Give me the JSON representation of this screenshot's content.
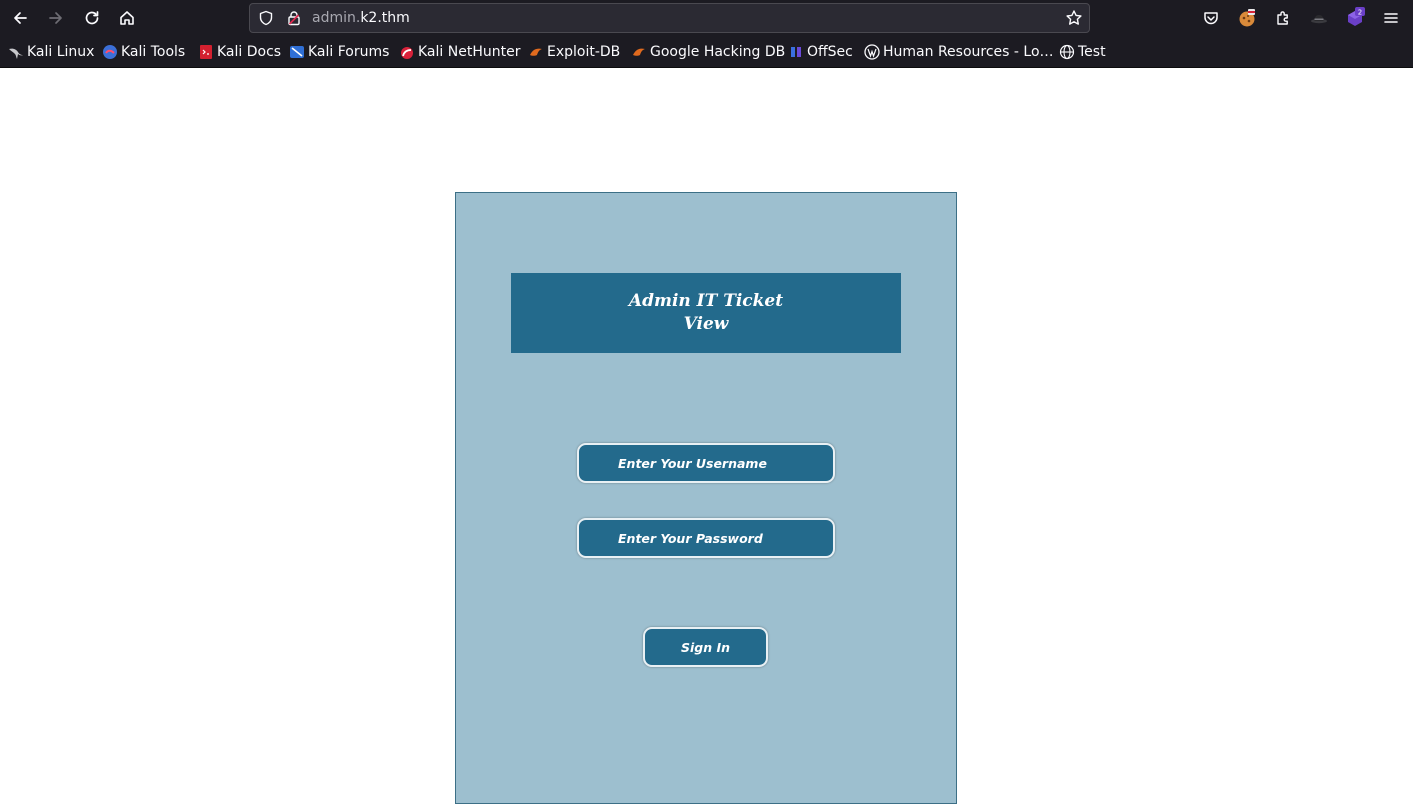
{
  "browser": {
    "url_host_prefix": "admin.",
    "url_host_domain": "k2.thm",
    "extensions_badge": "2",
    "icons": {
      "back": "back-arrow-icon",
      "forward": "forward-arrow-icon",
      "reload": "reload-icon",
      "home": "home-icon",
      "shield": "tracking-shield-icon",
      "lock": "lock-icon",
      "bookmark_star": "star-icon",
      "pocket": "pocket-icon",
      "menu": "hamburger-menu-icon"
    },
    "bookmarks": [
      {
        "label": "Kali Linux"
      },
      {
        "label": "Kali Tools"
      },
      {
        "label": "Kali Docs"
      },
      {
        "label": "Kali Forums"
      },
      {
        "label": "Kali NetHunter"
      },
      {
        "label": "Exploit-DB"
      },
      {
        "label": "Google Hacking DB"
      },
      {
        "label": "OffSec"
      },
      {
        "label": "Human Resources - Lo…"
      },
      {
        "label": "Test"
      }
    ]
  },
  "login": {
    "title": "Admin IT Ticket View",
    "username_placeholder": "Enter Your Username",
    "password_placeholder": "Enter Your Password",
    "signin_label": "Sign In"
  },
  "colors": {
    "card_bg": "#9dbfcf",
    "accent": "#236a8c",
    "chrome_bg": "#1c1b22"
  }
}
